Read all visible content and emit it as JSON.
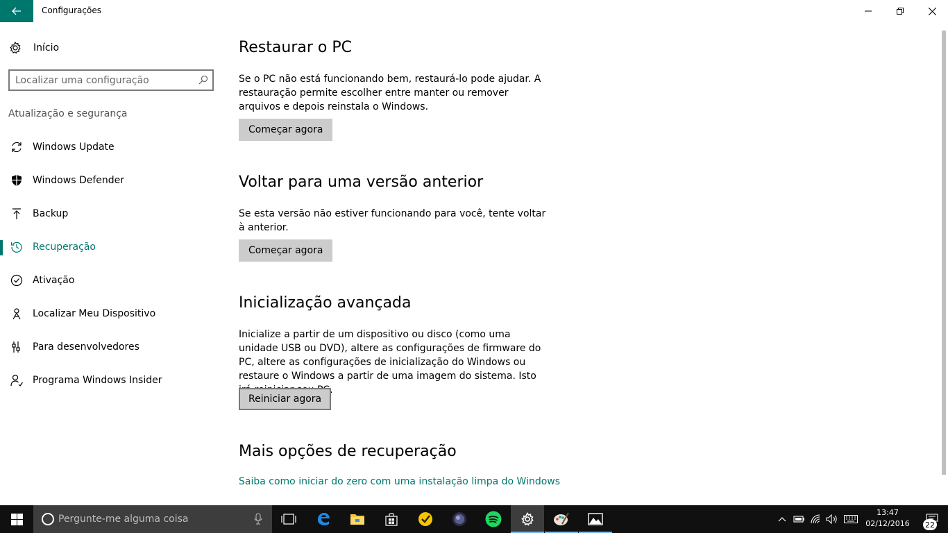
{
  "window": {
    "title": "Configurações",
    "minimize_icon": "minimize-icon",
    "maximize_icon": "restore-icon",
    "close_icon": "close-icon"
  },
  "sidebar": {
    "home_label": "Início",
    "search_placeholder": "Localizar uma configuração",
    "section_header": "Atualização e segurança",
    "items": [
      {
        "label": "Windows Update",
        "icon": "refresh-icon"
      },
      {
        "label": "Windows Defender",
        "icon": "shield-icon"
      },
      {
        "label": "Backup",
        "icon": "upload-icon"
      },
      {
        "label": "Recuperação",
        "icon": "history-icon",
        "active": true
      },
      {
        "label": "Ativação",
        "icon": "check-circle-icon"
      },
      {
        "label": "Localizar Meu Dispositivo",
        "icon": "person-location-icon"
      },
      {
        "label": "Para desenvolvedores",
        "icon": "developer-tools-icon"
      },
      {
        "label": "Programa Windows Insider",
        "icon": "insider-person-icon"
      }
    ]
  },
  "main": {
    "restore": {
      "title": "Restaurar o PC",
      "description": "Se o PC não está funcionando bem, restaurá-lo pode ajudar. A restauração permite escolher entre manter ou remover arquivos e depois reinstala o Windows.",
      "button": "Começar agora"
    },
    "rollback": {
      "title": "Voltar para uma versão anterior",
      "description": "Se esta versão não estiver funcionando para você, tente voltar à anterior.",
      "button": "Começar agora"
    },
    "advanced": {
      "title": "Inicialização avançada",
      "description": "Inicialize a partir de um dispositivo ou disco (como uma unidade USB ou DVD), altere as configurações de firmware do PC, altere as configurações de inicialização do Windows ou restaure o Windows a partir de uma imagem do sistema. Isto irá reiniciar seu PC.",
      "button": "Reiniciar agora"
    },
    "more": {
      "title": "Mais opções de recuperação",
      "link": "Saiba como iniciar do zero com uma instalação limpa do Windows"
    }
  },
  "taskbar": {
    "search_placeholder": "Pergunte-me alguma coisa",
    "apps": [
      "task-view-icon",
      "edge-icon",
      "file-explorer-icon",
      "store-icon",
      "norton-icon",
      "media-icon",
      "spotify-icon",
      "settings-icon",
      "paint-icon",
      "photos-icon"
    ],
    "time": "13:47",
    "date": "02/12/2016",
    "notification_count": "22"
  },
  "colors": {
    "accent": "#00776c",
    "taskbar": "#101010",
    "button": "#cccccc"
  }
}
